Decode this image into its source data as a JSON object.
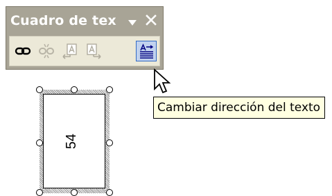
{
  "toolbar": {
    "title": "Cuadro de tex",
    "dropdown_icon": "triangle-down-icon",
    "close_icon": "close-icon",
    "buttons": [
      {
        "name": "create-link-button",
        "icon": "chain-link-icon",
        "enabled": true
      },
      {
        "name": "break-link-button",
        "icon": "broken-link-icon",
        "enabled": false
      },
      {
        "name": "previous-textbox-button",
        "icon": "previous-textbox-icon",
        "enabled": false
      },
      {
        "name": "next-textbox-button",
        "icon": "next-textbox-icon",
        "enabled": false
      },
      {
        "name": "change-text-direction-button",
        "icon": "text-direction-icon",
        "enabled": true,
        "active": true
      }
    ]
  },
  "textbox": {
    "value": "54",
    "orientation": "vertical"
  },
  "tooltip": {
    "text": "Cambiar dirección del texto"
  },
  "colors": {
    "toolbar_title_bg": "#a8a496",
    "toolbar_body_bg": "#ece9d8",
    "active_button_bg": "#c1d2ee",
    "active_button_border": "#316ac5",
    "tooltip_bg": "#ffffe1"
  }
}
